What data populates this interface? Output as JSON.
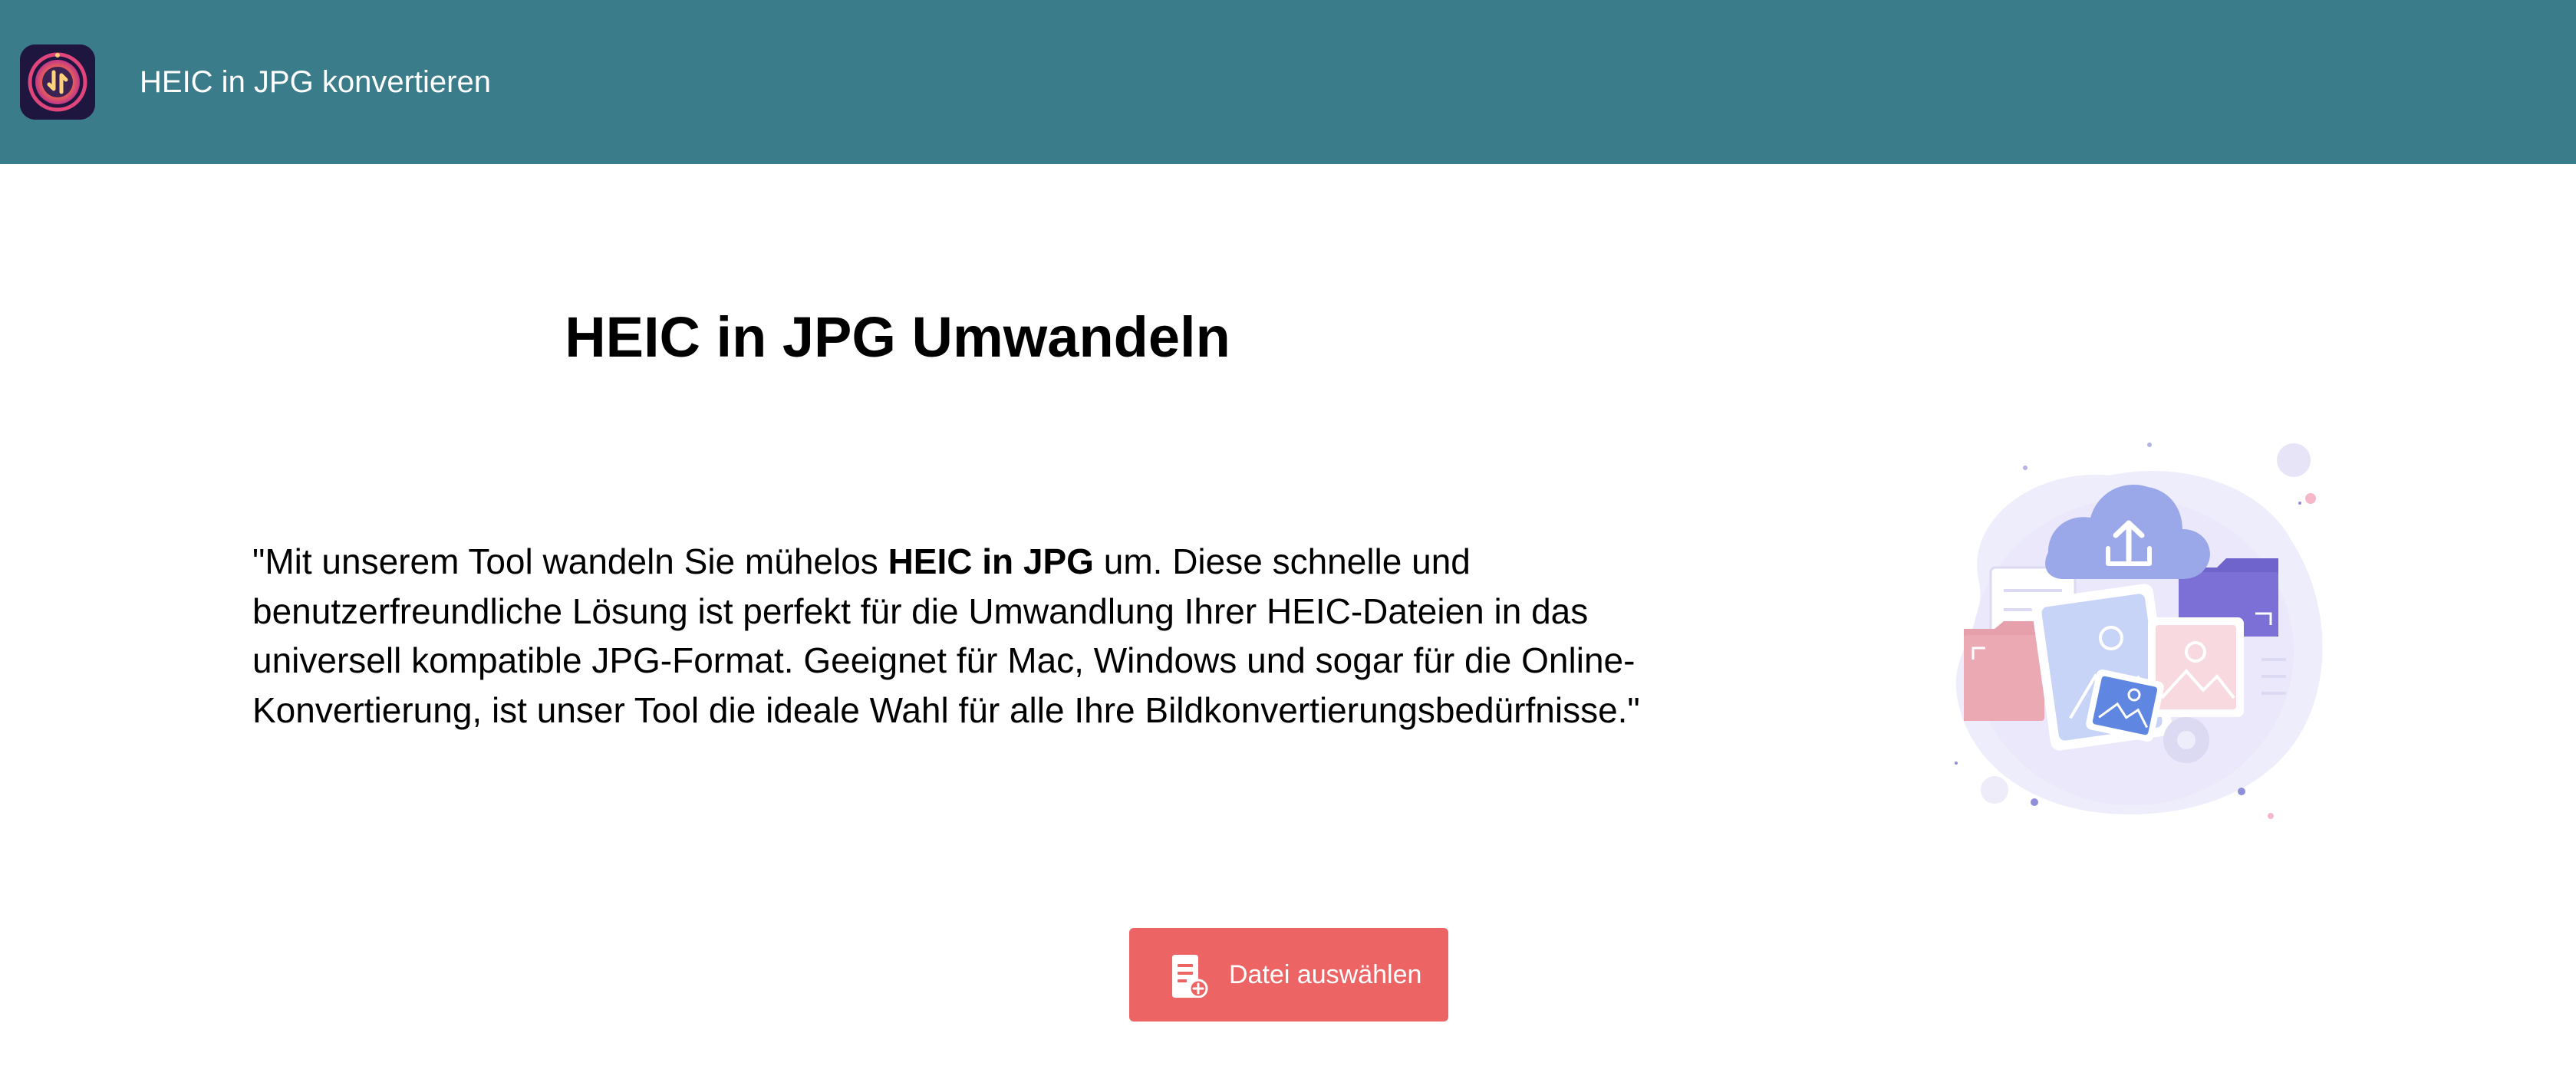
{
  "header": {
    "app_logo_icon": "heic-converter-logo-icon",
    "title": "HEIC in JPG konvertieren",
    "background_color": "#3a7c8a"
  },
  "main": {
    "heading": "HEIC in JPG Umwandeln",
    "description": {
      "line1_before_bold": "\"Mit unserem Tool wandeln Sie mühelos ",
      "line1_bold": "HEIC in JPG",
      "line1_after_bold": " um. Diese schnelle und",
      "line2": "benutzerfreundliche Lösung ist perfekt für die Umwandlung Ihrer HEIC-Dateien in das",
      "line3": "universell kompatible JPG-Format. Geeignet für Mac, Windows und sogar für die Online-",
      "line4": "Konvertierung, ist unser Tool die ideale Wahl für alle Ihre Bildkonvertierungsbedürfnisse.\""
    },
    "illustration_icon": "cloud-upload-files-illustration",
    "upload_button": {
      "label": "Datei auswählen",
      "icon": "file-add-icon",
      "color": "#ec6464"
    }
  }
}
